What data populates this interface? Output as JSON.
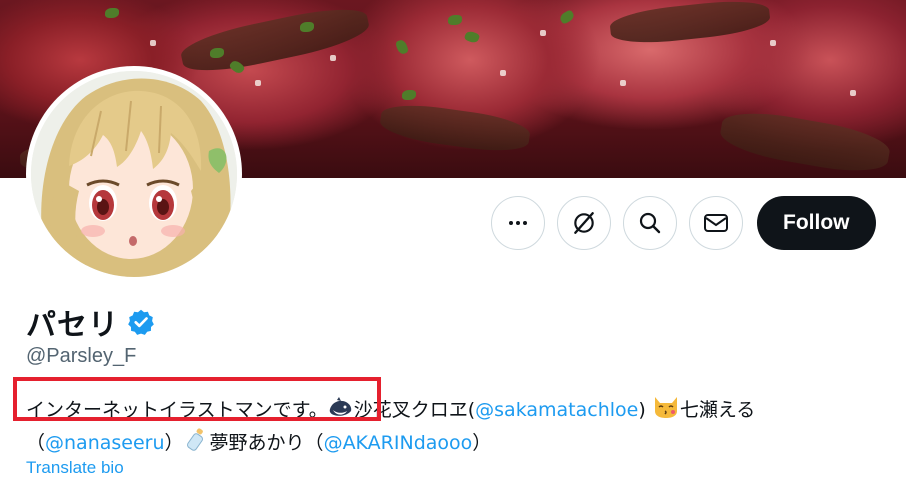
{
  "profile": {
    "display_name": "パセリ",
    "handle": "@Parsley_F",
    "verified": true
  },
  "banner": {
    "description": ""
  },
  "actions": {
    "more_icon": "more-icon",
    "grok_icon": "grok-icon",
    "search_icon": "search-icon",
    "message_icon": "mail-icon",
    "follow_label": "Follow"
  },
  "bio": {
    "intro": "インターネットイラストマンです。",
    "segment1_name": "沙花叉クロヱ(",
    "segment1_mention": "@sakamatachloe",
    "segment1_close": ")",
    "segment2_name": "七瀬える",
    "segment2_open": "（",
    "segment2_mention": "@nanaseeru",
    "segment2_close": "）",
    "segment3_name": "夢野あかり（",
    "segment3_mention": "@AKARINdaooo",
    "segment3_close": "）",
    "emojis": [
      "orca-emoji",
      "kissing-cat-emoji",
      "baby-bottle-emoji"
    ]
  },
  "translate_label": "Translate bio",
  "colors": {
    "accent": "#1d9bf0",
    "highlight": "#e5202e",
    "follow_bg": "#0f1419"
  }
}
